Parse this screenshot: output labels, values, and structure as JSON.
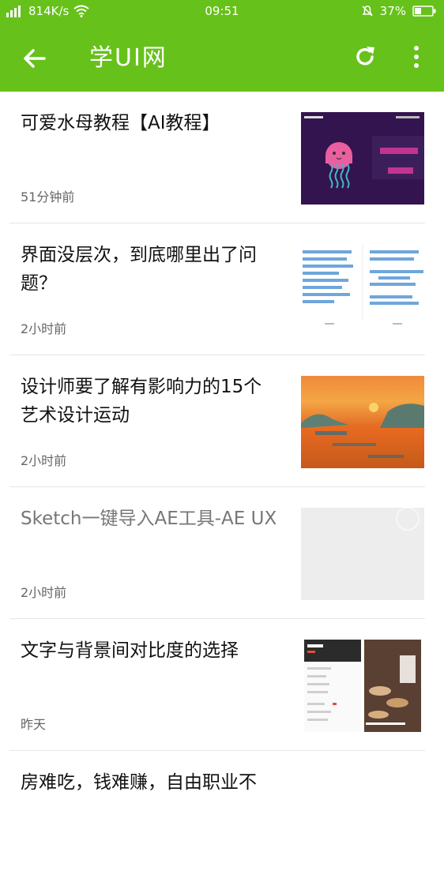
{
  "status_bar": {
    "network_speed": "814K/s",
    "time": "09:51",
    "battery": "37%"
  },
  "app_bar": {
    "title": "学UI网"
  },
  "colors": {
    "accent": "#66c11a"
  },
  "icons": {
    "back": "arrow-left-icon",
    "refresh": "refresh-icon",
    "more": "more-vertical-icon"
  },
  "articles": [
    {
      "title": "可爱水母教程【AI教程】",
      "time": "51分钟前"
    },
    {
      "title": "界面没层次，到底哪里出了问题？",
      "time": "2小时前"
    },
    {
      "title": "设计师要了解有影响力的15个艺术设计运动",
      "time": "2小时前"
    },
    {
      "title": "Sketch一键导入AE工具-AE UX",
      "time": "2小时前"
    },
    {
      "title": "文字与背景间对比度的选择",
      "time": "昨天"
    },
    {
      "title": "房难吃，钱难赚，自由职业不",
      "time": ""
    }
  ]
}
